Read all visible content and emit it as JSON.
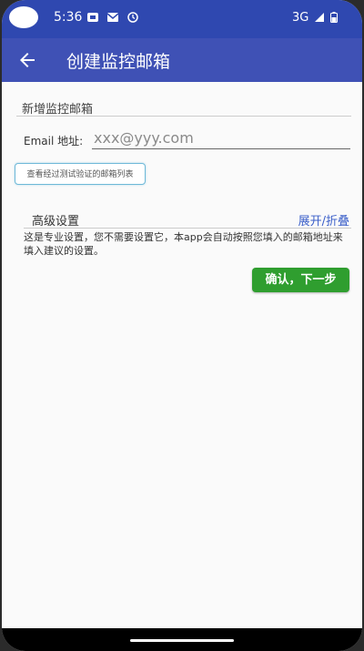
{
  "status_bar": {
    "time": "5:36",
    "network": "3G",
    "icons": [
      "notification-icon",
      "mail-icon",
      "alarm-icon",
      "signal-icon",
      "battery-icon"
    ]
  },
  "app_bar": {
    "title": "创建监控邮箱",
    "back_icon": "arrow-left-icon"
  },
  "form": {
    "section_title": "新增监控邮箱",
    "email_label": "Email 地址:",
    "email_placeholder": "xxx@yyy.com",
    "email_value": "",
    "tested_list_button": "查看经过测试验证的邮箱列表"
  },
  "advanced": {
    "title": "高级设置",
    "toggle_link": "展开/折叠",
    "description": "这是专业设置，您不需要设置它，本app会自动按照您填入的邮箱地址来填入建议的设置。"
  },
  "actions": {
    "confirm_label": "确认，下一步"
  },
  "colors": {
    "status_bar": "#2f48b0",
    "app_bar": "#3f51b5",
    "confirm": "#2f9e2f",
    "link": "#3b5fc9"
  }
}
